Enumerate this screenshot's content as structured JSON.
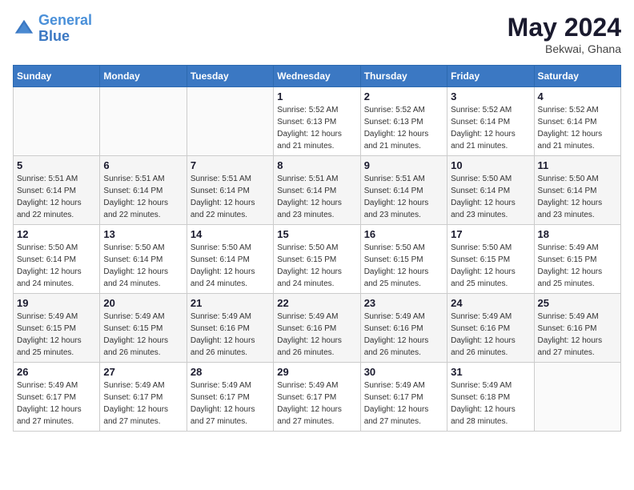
{
  "header": {
    "logo_line1": "General",
    "logo_line2": "Blue",
    "month_year": "May 2024",
    "location": "Bekwai, Ghana"
  },
  "weekdays": [
    "Sunday",
    "Monday",
    "Tuesday",
    "Wednesday",
    "Thursday",
    "Friday",
    "Saturday"
  ],
  "weeks": [
    [
      {
        "day": "",
        "detail": ""
      },
      {
        "day": "",
        "detail": ""
      },
      {
        "day": "",
        "detail": ""
      },
      {
        "day": "1",
        "detail": "Sunrise: 5:52 AM\nSunset: 6:13 PM\nDaylight: 12 hours\nand 21 minutes."
      },
      {
        "day": "2",
        "detail": "Sunrise: 5:52 AM\nSunset: 6:13 PM\nDaylight: 12 hours\nand 21 minutes."
      },
      {
        "day": "3",
        "detail": "Sunrise: 5:52 AM\nSunset: 6:14 PM\nDaylight: 12 hours\nand 21 minutes."
      },
      {
        "day": "4",
        "detail": "Sunrise: 5:52 AM\nSunset: 6:14 PM\nDaylight: 12 hours\nand 21 minutes."
      }
    ],
    [
      {
        "day": "5",
        "detail": "Sunrise: 5:51 AM\nSunset: 6:14 PM\nDaylight: 12 hours\nand 22 minutes."
      },
      {
        "day": "6",
        "detail": "Sunrise: 5:51 AM\nSunset: 6:14 PM\nDaylight: 12 hours\nand 22 minutes."
      },
      {
        "day": "7",
        "detail": "Sunrise: 5:51 AM\nSunset: 6:14 PM\nDaylight: 12 hours\nand 22 minutes."
      },
      {
        "day": "8",
        "detail": "Sunrise: 5:51 AM\nSunset: 6:14 PM\nDaylight: 12 hours\nand 23 minutes."
      },
      {
        "day": "9",
        "detail": "Sunrise: 5:51 AM\nSunset: 6:14 PM\nDaylight: 12 hours\nand 23 minutes."
      },
      {
        "day": "10",
        "detail": "Sunrise: 5:50 AM\nSunset: 6:14 PM\nDaylight: 12 hours\nand 23 minutes."
      },
      {
        "day": "11",
        "detail": "Sunrise: 5:50 AM\nSunset: 6:14 PM\nDaylight: 12 hours\nand 23 minutes."
      }
    ],
    [
      {
        "day": "12",
        "detail": "Sunrise: 5:50 AM\nSunset: 6:14 PM\nDaylight: 12 hours\nand 24 minutes."
      },
      {
        "day": "13",
        "detail": "Sunrise: 5:50 AM\nSunset: 6:14 PM\nDaylight: 12 hours\nand 24 minutes."
      },
      {
        "day": "14",
        "detail": "Sunrise: 5:50 AM\nSunset: 6:14 PM\nDaylight: 12 hours\nand 24 minutes."
      },
      {
        "day": "15",
        "detail": "Sunrise: 5:50 AM\nSunset: 6:15 PM\nDaylight: 12 hours\nand 24 minutes."
      },
      {
        "day": "16",
        "detail": "Sunrise: 5:50 AM\nSunset: 6:15 PM\nDaylight: 12 hours\nand 25 minutes."
      },
      {
        "day": "17",
        "detail": "Sunrise: 5:50 AM\nSunset: 6:15 PM\nDaylight: 12 hours\nand 25 minutes."
      },
      {
        "day": "18",
        "detail": "Sunrise: 5:49 AM\nSunset: 6:15 PM\nDaylight: 12 hours\nand 25 minutes."
      }
    ],
    [
      {
        "day": "19",
        "detail": "Sunrise: 5:49 AM\nSunset: 6:15 PM\nDaylight: 12 hours\nand 25 minutes."
      },
      {
        "day": "20",
        "detail": "Sunrise: 5:49 AM\nSunset: 6:15 PM\nDaylight: 12 hours\nand 26 minutes."
      },
      {
        "day": "21",
        "detail": "Sunrise: 5:49 AM\nSunset: 6:16 PM\nDaylight: 12 hours\nand 26 minutes."
      },
      {
        "day": "22",
        "detail": "Sunrise: 5:49 AM\nSunset: 6:16 PM\nDaylight: 12 hours\nand 26 minutes."
      },
      {
        "day": "23",
        "detail": "Sunrise: 5:49 AM\nSunset: 6:16 PM\nDaylight: 12 hours\nand 26 minutes."
      },
      {
        "day": "24",
        "detail": "Sunrise: 5:49 AM\nSunset: 6:16 PM\nDaylight: 12 hours\nand 26 minutes."
      },
      {
        "day": "25",
        "detail": "Sunrise: 5:49 AM\nSunset: 6:16 PM\nDaylight: 12 hours\nand 27 minutes."
      }
    ],
    [
      {
        "day": "26",
        "detail": "Sunrise: 5:49 AM\nSunset: 6:17 PM\nDaylight: 12 hours\nand 27 minutes."
      },
      {
        "day": "27",
        "detail": "Sunrise: 5:49 AM\nSunset: 6:17 PM\nDaylight: 12 hours\nand 27 minutes."
      },
      {
        "day": "28",
        "detail": "Sunrise: 5:49 AM\nSunset: 6:17 PM\nDaylight: 12 hours\nand 27 minutes."
      },
      {
        "day": "29",
        "detail": "Sunrise: 5:49 AM\nSunset: 6:17 PM\nDaylight: 12 hours\nand 27 minutes."
      },
      {
        "day": "30",
        "detail": "Sunrise: 5:49 AM\nSunset: 6:17 PM\nDaylight: 12 hours\nand 27 minutes."
      },
      {
        "day": "31",
        "detail": "Sunrise: 5:49 AM\nSunset: 6:18 PM\nDaylight: 12 hours\nand 28 minutes."
      },
      {
        "day": "",
        "detail": ""
      }
    ]
  ]
}
